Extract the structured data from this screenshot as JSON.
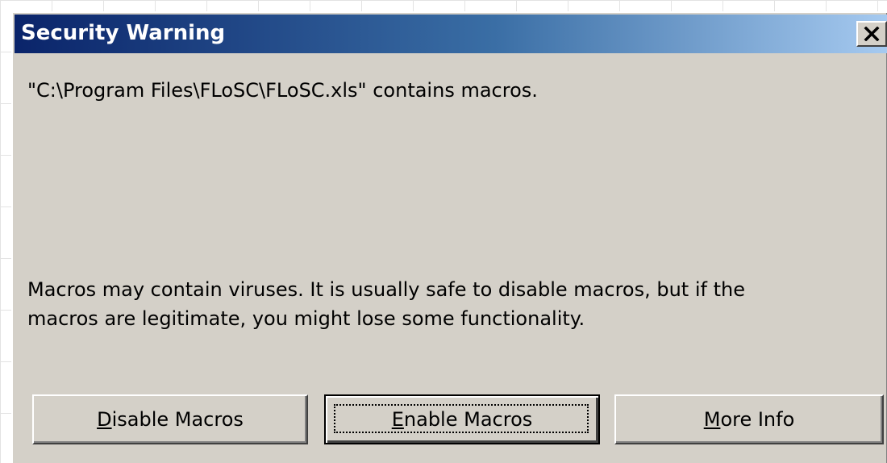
{
  "dialog": {
    "title": "Security Warning",
    "close_icon": "close-icon",
    "file_message": "\"C:\\Program Files\\FLoSC\\FLoSC.xls\" contains macros.",
    "warning_line1": "Macros may contain viruses. It is usually safe to disable macros, but if the",
    "warning_line2": "macros are legitimate, you might lose some functionality."
  },
  "buttons": {
    "disable": {
      "accel": "D",
      "rest": "isable Macros"
    },
    "enable": {
      "accel": "E",
      "rest": "nable Macros"
    },
    "more": {
      "accel": "M",
      "rest": "ore Info"
    }
  },
  "colors": {
    "face": "#d4d0c8",
    "title_start": "#0a246a",
    "title_end": "#a6caf0",
    "title_text": "#ffffff"
  }
}
